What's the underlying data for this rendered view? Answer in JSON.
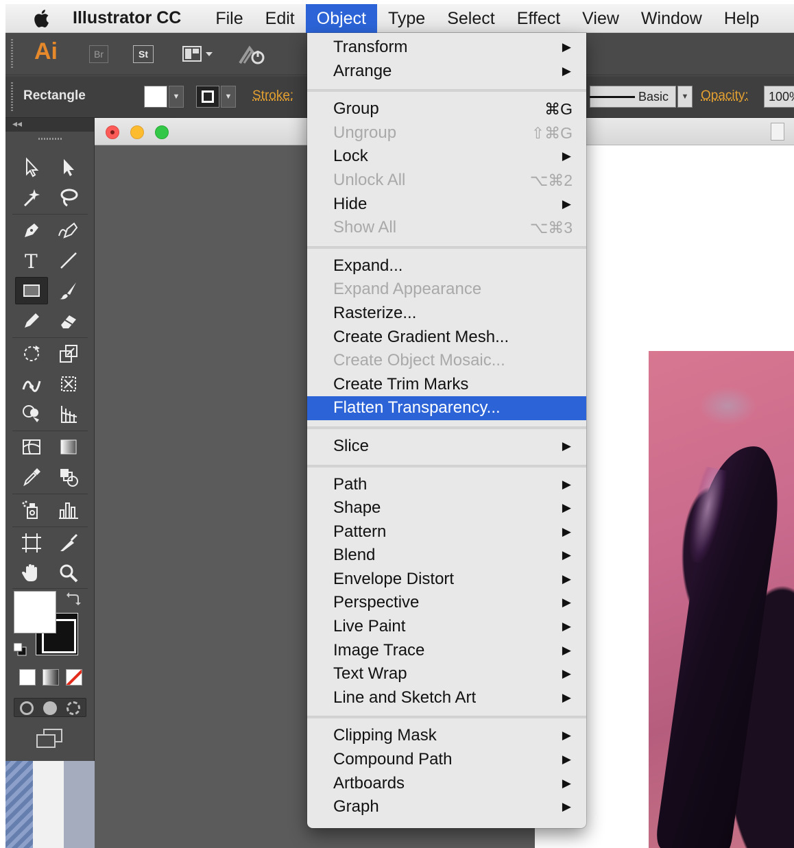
{
  "menubar": {
    "app_name": "Illustrator CC",
    "items": [
      "File",
      "Edit",
      "Object",
      "Type",
      "Select",
      "Effect",
      "View",
      "Window",
      "Help"
    ],
    "active": "Object"
  },
  "appbar": {
    "logo": "Ai",
    "bridge": "Br",
    "stock": "St"
  },
  "controlbar": {
    "tool_name": "Rectangle",
    "stroke_label": "Stroke:",
    "style_value": "Basic",
    "opacity_label": "Opacity:",
    "opacity_value": "100%"
  },
  "icons": {
    "apple": "apple-icon",
    "menu_arrow": "▶"
  },
  "menu": {
    "groups": [
      [
        {
          "label": "Transform",
          "submenu": true
        },
        {
          "label": "Arrange",
          "submenu": true
        }
      ],
      [
        {
          "label": "Group",
          "shortcut": "⌘G"
        },
        {
          "label": "Ungroup",
          "shortcut": "⇧⌘G",
          "disabled": true
        },
        {
          "label": "Lock",
          "submenu": true
        },
        {
          "label": "Unlock All",
          "shortcut": "⌥⌘2",
          "disabled": true
        },
        {
          "label": "Hide",
          "submenu": true
        },
        {
          "label": "Show All",
          "shortcut": "⌥⌘3",
          "disabled": true
        }
      ],
      [
        {
          "label": "Expand..."
        },
        {
          "label": "Expand Appearance",
          "disabled": true
        },
        {
          "label": "Rasterize..."
        },
        {
          "label": "Create Gradient Mesh..."
        },
        {
          "label": "Create Object Mosaic...",
          "disabled": true
        },
        {
          "label": "Create Trim Marks"
        },
        {
          "label": "Flatten Transparency...",
          "highlighted": true
        }
      ],
      [
        {
          "label": "Slice",
          "submenu": true
        }
      ],
      [
        {
          "label": "Path",
          "submenu": true
        },
        {
          "label": "Shape",
          "submenu": true
        },
        {
          "label": "Pattern",
          "submenu": true
        },
        {
          "label": "Blend",
          "submenu": true
        },
        {
          "label": "Envelope Distort",
          "submenu": true
        },
        {
          "label": "Perspective",
          "submenu": true
        },
        {
          "label": "Live Paint",
          "submenu": true
        },
        {
          "label": "Image Trace",
          "submenu": true
        },
        {
          "label": "Text Wrap",
          "submenu": true
        },
        {
          "label": "Line and Sketch Art",
          "submenu": true
        }
      ],
      [
        {
          "label": "Clipping Mask",
          "submenu": true
        },
        {
          "label": "Compound Path",
          "submenu": true
        },
        {
          "label": "Artboards",
          "submenu": true
        },
        {
          "label": "Graph",
          "submenu": true
        }
      ]
    ]
  },
  "colors": {
    "highlight": "#2c64d8",
    "ai_orange": "#e6892b",
    "traffic_red": "#fc5b57",
    "traffic_yellow": "#fdbc2e",
    "traffic_green": "#33c748"
  }
}
